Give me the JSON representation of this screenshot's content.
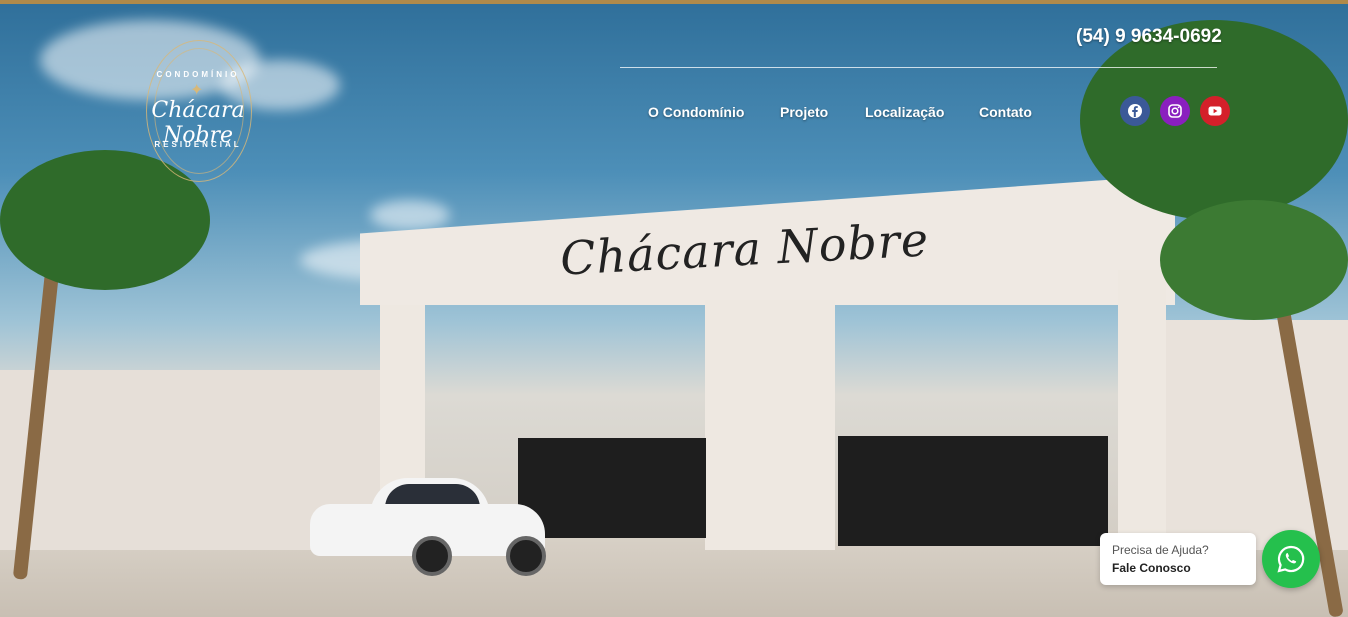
{
  "header": {
    "phone": "(54) 9 9634-0692",
    "logo": {
      "top_text": "CONDOMÍNIO",
      "name": "Chácara Nobre",
      "bottom_text": "RESIDENCIAL"
    },
    "nav": [
      {
        "label": "O Condomínio"
      },
      {
        "label": "Projeto"
      },
      {
        "label": "Localização"
      },
      {
        "label": "Contato"
      }
    ],
    "social": [
      {
        "icon": "facebook-icon",
        "color": "#3b5998"
      },
      {
        "icon": "instagram-icon",
        "color": "#8a1fbf"
      },
      {
        "icon": "youtube-icon",
        "color": "#d4202a"
      }
    ]
  },
  "hero": {
    "gate_sign": "Chácara Nobre"
  },
  "help_widget": {
    "line1": "Precisa de Ajuda?",
    "line2": "Fale Conosco",
    "whatsapp_color": "#25c04d"
  },
  "colors": {
    "accent_bar": "#b08a4a"
  }
}
